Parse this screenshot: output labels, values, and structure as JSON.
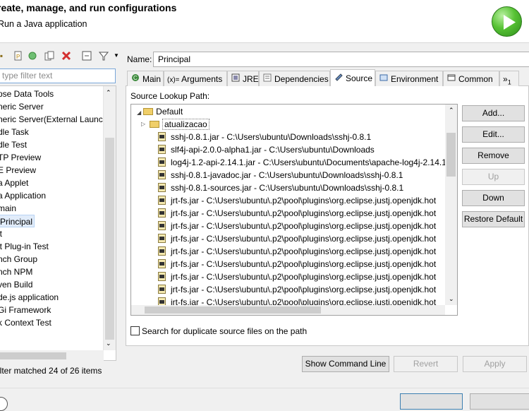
{
  "header": {
    "title": "reate, manage, and run configurations",
    "subtitle": "Run a Java application"
  },
  "left_panel": {
    "filter_placeholder": "type filter text",
    "tree_items": [
      {
        "label": "pse Data Tools",
        "selected": false
      },
      {
        "label": "neric Server",
        "selected": false
      },
      {
        "label": "neric Server(External Launch)",
        "selected": false
      },
      {
        "label": "dle Task",
        "selected": false
      },
      {
        "label": "dle Test",
        "selected": false
      },
      {
        "label": "TP Preview",
        "selected": false
      },
      {
        "label": "E Preview",
        "selected": false
      },
      {
        "label": "a Applet",
        "selected": false
      },
      {
        "label": "a Application",
        "selected": false
      },
      {
        "label": "main",
        "selected": false
      },
      {
        "label": "Principal",
        "selected": true
      },
      {
        "label": "it",
        "selected": false
      },
      {
        "label": "it Plug-in Test",
        "selected": false
      },
      {
        "label": "nch Group",
        "selected": false
      },
      {
        "label": "nch NPM",
        "selected": false
      },
      {
        "label": "ven Build",
        "selected": false
      },
      {
        "label": "de.js application",
        "selected": false
      },
      {
        "label": "Gi Framework",
        "selected": false
      },
      {
        "label": "k Context Test",
        "selected": false
      }
    ],
    "filter_status": "ilter matched 24 of 26 items"
  },
  "config": {
    "name_label": "Name:",
    "name_value": "Principal",
    "tabs": [
      {
        "label": "Main",
        "icon": "main-tab-icon"
      },
      {
        "label": "Arguments",
        "icon": "arguments-tab-icon"
      },
      {
        "label": "JRE",
        "icon": "jre-tab-icon"
      },
      {
        "label": "Dependencies",
        "icon": "dependencies-tab-icon"
      },
      {
        "label": "Source",
        "icon": "source-tab-icon"
      },
      {
        "label": "Environment",
        "icon": "environment-tab-icon"
      },
      {
        "label": "Common",
        "icon": "common-tab-icon"
      },
      {
        "label": "»",
        "badge": "1"
      }
    ],
    "arguments_prefix": "(x)=",
    "source_lookup_label": "Source Lookup Path:",
    "default_label": "Default",
    "entries": [
      {
        "label": "atualizacao",
        "kind": "project"
      },
      {
        "label": "sshj-0.8.1.jar - C:\\Users\\ubuntu\\Downloads\\sshj-0.8.1",
        "kind": "jar"
      },
      {
        "label": "slf4j-api-2.0.0-alpha1.jar - C:\\Users\\ubuntu\\Downloads",
        "kind": "jar"
      },
      {
        "label": "log4j-1.2-api-2.14.1.jar - C:\\Users\\ubuntu\\Documents\\apache-log4j-2.14.1",
        "kind": "jar"
      },
      {
        "label": "sshj-0.8.1-javadoc.jar - C:\\Users\\ubuntu\\Downloads\\sshj-0.8.1",
        "kind": "jar"
      },
      {
        "label": "sshj-0.8.1-sources.jar - C:\\Users\\ubuntu\\Downloads\\sshj-0.8.1",
        "kind": "jar"
      },
      {
        "label": "jrt-fs.jar - C:\\Users\\ubuntu\\.p2\\pool\\plugins\\org.eclipse.justj.openjdk.hot",
        "kind": "jar"
      },
      {
        "label": "jrt-fs.jar - C:\\Users\\ubuntu\\.p2\\pool\\plugins\\org.eclipse.justj.openjdk.hot",
        "kind": "jar"
      },
      {
        "label": "jrt-fs.jar - C:\\Users\\ubuntu\\.p2\\pool\\plugins\\org.eclipse.justj.openjdk.hot",
        "kind": "jar"
      },
      {
        "label": "jrt-fs.jar - C:\\Users\\ubuntu\\.p2\\pool\\plugins\\org.eclipse.justj.openjdk.hot",
        "kind": "jar"
      },
      {
        "label": "jrt-fs.jar - C:\\Users\\ubuntu\\.p2\\pool\\plugins\\org.eclipse.justj.openjdk.hot",
        "kind": "jar"
      },
      {
        "label": "jrt-fs.jar - C:\\Users\\ubuntu\\.p2\\pool\\plugins\\org.eclipse.justj.openjdk.hot",
        "kind": "jar"
      },
      {
        "label": "jrt-fs.jar - C:\\Users\\ubuntu\\.p2\\pool\\plugins\\org.eclipse.justj.openjdk.hot",
        "kind": "jar"
      },
      {
        "label": "jrt-fs.jar - C:\\Users\\ubuntu\\.p2\\pool\\plugins\\org.eclipse.justj.openjdk.hot",
        "kind": "jar"
      },
      {
        "label": "jrt-fs.jar - C:\\Users\\ubuntu\\.p2\\pool\\plugins\\org.eclipse.justj.openjdk.hot",
        "kind": "jar"
      }
    ],
    "side_buttons": {
      "add": "Add...",
      "edit": "Edit...",
      "remove": "Remove",
      "up": "Up",
      "down": "Down",
      "restore": "Restore Default"
    },
    "duplicate_check_label": "Search for duplicate source files on the path",
    "duplicate_checked": false,
    "show_command_line": "Show Command Line",
    "revert": "Revert",
    "apply": "Apply"
  },
  "colors": {
    "accent": "#3c7fb1",
    "selection": "#e1ecfa",
    "run_green": "#2e8f1c",
    "delete_red": "#d32f2f"
  }
}
